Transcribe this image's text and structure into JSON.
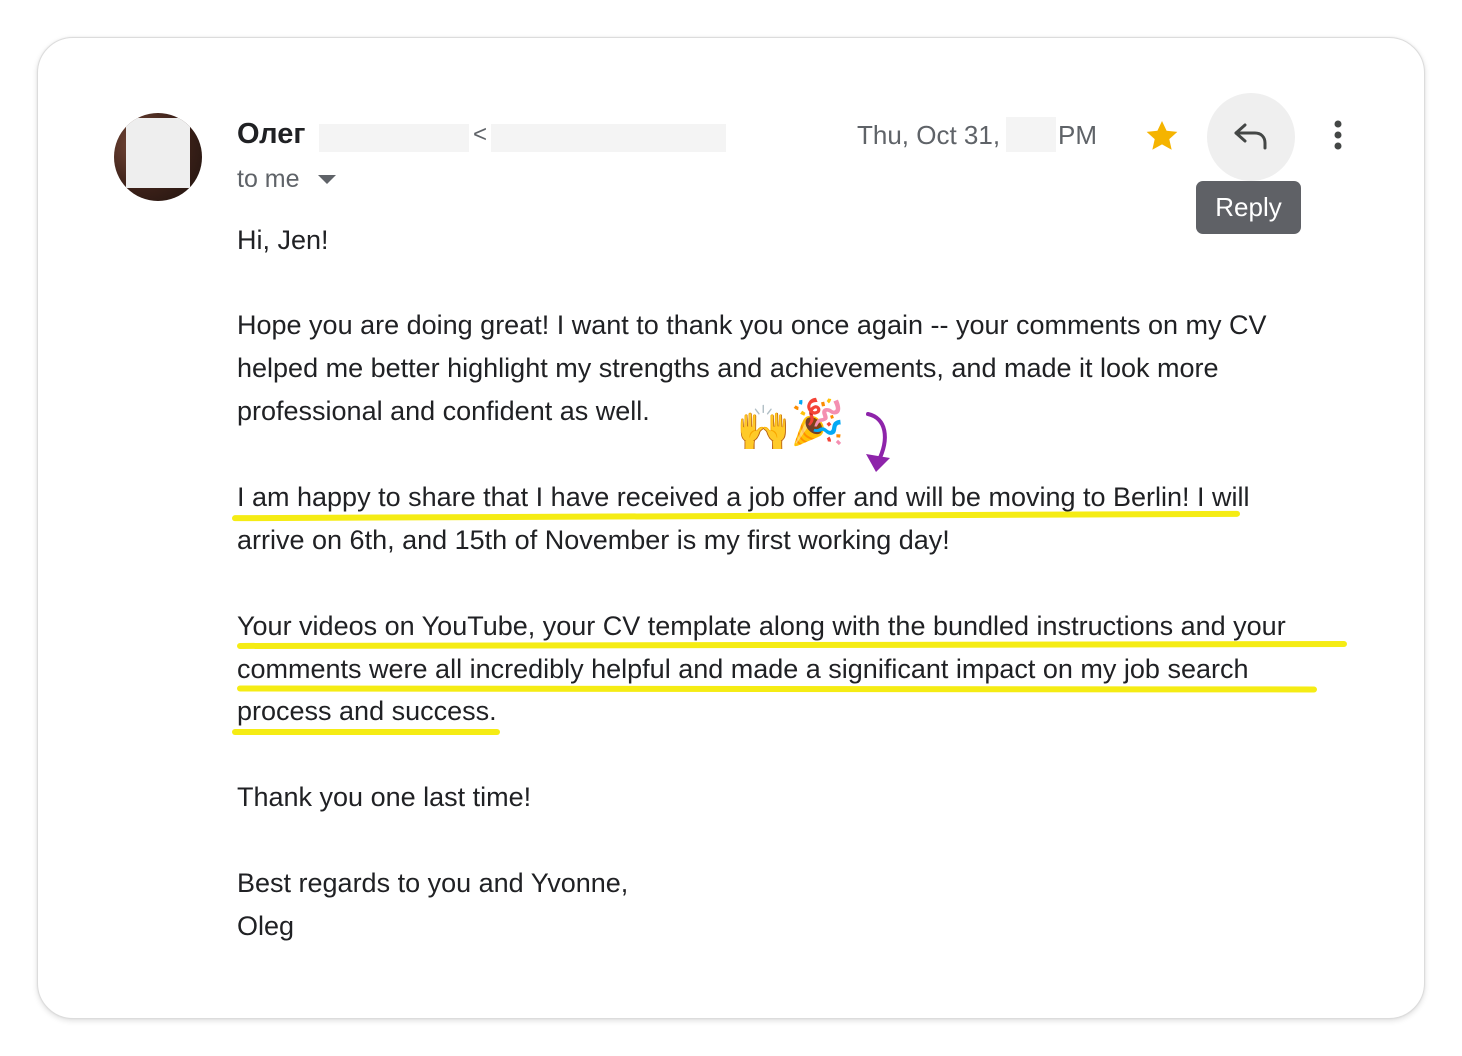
{
  "header": {
    "sender_name": "Олег",
    "sender_email_open": "<",
    "recipient": "to me",
    "date_prefix": "Thu, Oct 31,",
    "date_suffix": "PM",
    "reply_tooltip": "Reply",
    "star_color": "#f5b400"
  },
  "message": {
    "lines": [
      "Hi, Jen!",
      "Hope you are doing great! I want to thank you once again -- your comments on my CV",
      "helped me better highlight my strengths and achievements, and made it look more",
      "professional and confident as well.",
      "I am happy to share that I have received a job offer and will be moving to Berlin! I will",
      "arrive on 6th, and 15th of November is my first working day!",
      "Your videos on YouTube, your CV template along with the bundled instructions and your",
      "comments were  all incredibly helpful and made a significant impact on my job search",
      "process and success.",
      "Thank you one last time!",
      "Best regards to you and Yvonne,",
      "Oleg"
    ]
  },
  "annotations": {
    "emoji_hands": "🙌",
    "emoji_party": "🎉",
    "highlight_color": "#f5ec14",
    "arrow_color": "#8e24aa"
  }
}
